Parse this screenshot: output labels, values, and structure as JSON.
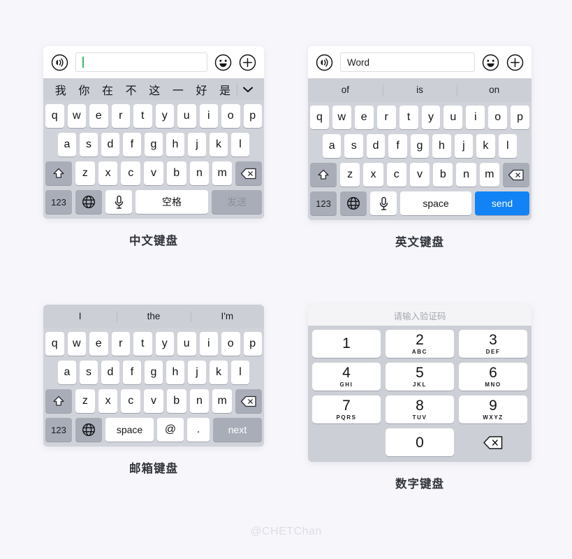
{
  "page": {
    "background_color": "#f7f7fb",
    "watermark": "@CHETChan"
  },
  "colors": {
    "keyboard_bg": "#d1d3da",
    "candidate_bar_bg": "#cdcfd6",
    "key_white": "#ffffff",
    "key_gray": "#a9adb8",
    "send_blue": "#1283f5",
    "caret_green": "#39b96a",
    "caption_text": "#32343c",
    "watermark_text": "#dcdde6"
  },
  "keyboards": {
    "chinese": {
      "caption": "中文键盘",
      "input_bar": {
        "voice_icon": "voice-icon",
        "value": "",
        "placeholder": "",
        "emoji_icon": "emoji-icon",
        "plus_icon": "plus-icon"
      },
      "candidates": [
        "我",
        "你",
        "在",
        "不",
        "这",
        "一",
        "好",
        "是"
      ],
      "expand_icon": "chevron-down-icon",
      "rows": {
        "row1": [
          "q",
          "w",
          "e",
          "r",
          "t",
          "y",
          "u",
          "i",
          "o",
          "p"
        ],
        "row2": [
          "a",
          "s",
          "d",
          "f",
          "g",
          "h",
          "j",
          "k",
          "l"
        ],
        "row3": [
          "z",
          "x",
          "c",
          "v",
          "b",
          "n",
          "m"
        ]
      },
      "shift_icon": "shift-icon",
      "delete_icon": "delete-icon",
      "bottom": {
        "numeric_label": "123",
        "globe_icon": "globe-icon",
        "mic_icon": "microphone-icon",
        "space_label": "空格",
        "action_label": "发送",
        "action_enabled": false
      }
    },
    "english": {
      "caption": "英文键盘",
      "input_bar": {
        "voice_icon": "voice-icon",
        "value": "Word",
        "placeholder": "",
        "emoji_icon": "emoji-icon",
        "plus_icon": "plus-icon"
      },
      "suggestions": [
        "of",
        "is",
        "on"
      ],
      "rows": {
        "row1": [
          "q",
          "w",
          "e",
          "r",
          "t",
          "y",
          "u",
          "i",
          "o",
          "p"
        ],
        "row2": [
          "a",
          "s",
          "d",
          "f",
          "g",
          "h",
          "j",
          "k",
          "l"
        ],
        "row3": [
          "z",
          "x",
          "c",
          "v",
          "b",
          "n",
          "m"
        ]
      },
      "shift_icon": "shift-icon",
      "delete_icon": "delete-icon",
      "bottom": {
        "numeric_label": "123",
        "globe_icon": "globe-icon",
        "mic_icon": "microphone-icon",
        "space_label": "space",
        "action_label": "send",
        "action_enabled": true
      }
    },
    "email": {
      "caption": "邮箱键盘",
      "suggestions": [
        "I",
        "the",
        "I'm"
      ],
      "rows": {
        "row1": [
          "q",
          "w",
          "e",
          "r",
          "t",
          "y",
          "u",
          "i",
          "o",
          "p"
        ],
        "row2": [
          "a",
          "s",
          "d",
          "f",
          "g",
          "h",
          "j",
          "k",
          "l"
        ],
        "row3": [
          "z",
          "x",
          "c",
          "v",
          "b",
          "n",
          "m"
        ]
      },
      "shift_icon": "shift-icon",
      "delete_icon": "delete-icon",
      "bottom": {
        "numeric_label": "123",
        "globe_icon": "globe-icon",
        "space_label": "space",
        "at_label": "@",
        "dot_label": ".",
        "action_label": "next"
      }
    },
    "numeric": {
      "caption": "数字键盘",
      "header": "请输入验证码",
      "keys": [
        [
          {
            "digit": "1",
            "letters": ""
          },
          {
            "digit": "2",
            "letters": "ABC"
          },
          {
            "digit": "3",
            "letters": "DEF"
          }
        ],
        [
          {
            "digit": "4",
            "letters": "GHI"
          },
          {
            "digit": "5",
            "letters": "JKL"
          },
          {
            "digit": "6",
            "letters": "MNO"
          }
        ],
        [
          {
            "digit": "7",
            "letters": "PQRS"
          },
          {
            "digit": "8",
            "letters": "TUV"
          },
          {
            "digit": "9",
            "letters": "WXYZ"
          }
        ]
      ],
      "zero": {
        "digit": "0",
        "letters": ""
      },
      "delete_icon": "delete-icon"
    }
  }
}
